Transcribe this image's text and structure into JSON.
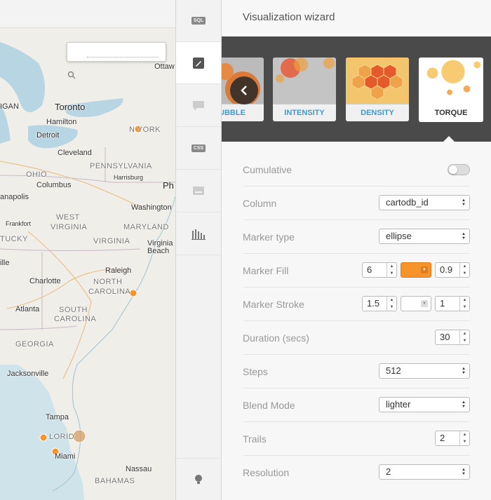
{
  "map": {
    "search": {
      "placeholder": ""
    },
    "labels": [
      {
        "id": "ottawa",
        "text": "Ottaw"
      },
      {
        "id": "toronto",
        "text": "Toronto"
      },
      {
        "id": "hamilton",
        "text": "Hamilton"
      },
      {
        "id": "michigan",
        "text": "IGAN"
      },
      {
        "id": "detroit",
        "text": "Detroit"
      },
      {
        "id": "newyork",
        "text": "N  YORK"
      },
      {
        "id": "cleveland",
        "text": "Cleveland"
      },
      {
        "id": "ohio",
        "text": "OHIO"
      },
      {
        "id": "pennsylvania",
        "text": "PENNSYLVANIA"
      },
      {
        "id": "harrisburg",
        "text": "Harrisburg"
      },
      {
        "id": "columbus",
        "text": "Columbus"
      },
      {
        "id": "ph",
        "text": "Ph"
      },
      {
        "id": "indianapolis",
        "text": "anapolis"
      },
      {
        "id": "westvirginia1",
        "text": "WEST"
      },
      {
        "id": "washington",
        "text": "Washington"
      },
      {
        "id": "frankfort",
        "text": "Frankfort"
      },
      {
        "id": "westvirginia2",
        "text": "VIRGINIA"
      },
      {
        "id": "maryland",
        "text": "MARYLAND"
      },
      {
        "id": "kentucky",
        "text": "TUCKY"
      },
      {
        "id": "virginia",
        "text": "VIRGINIA"
      },
      {
        "id": "virginiabeach1",
        "text": "Virginia"
      },
      {
        "id": "virginiabeach2",
        "text": "Beach"
      },
      {
        "id": "nashville",
        "text": "ille"
      },
      {
        "id": "raleigh",
        "text": "Raleigh"
      },
      {
        "id": "charlotte",
        "text": "Charlotte"
      },
      {
        "id": "northcarolina1",
        "text": "NORTH"
      },
      {
        "id": "northcarolina2",
        "text": "CAROLINA"
      },
      {
        "id": "atlanta",
        "text": "Atlanta"
      },
      {
        "id": "southcarolina1",
        "text": "SOUTH"
      },
      {
        "id": "southcarolina2",
        "text": "CAROLINA"
      },
      {
        "id": "georgia",
        "text": "GEORGIA"
      },
      {
        "id": "jacksonville",
        "text": "Jacksonville"
      },
      {
        "id": "tampa",
        "text": "Tampa"
      },
      {
        "id": "florida",
        "text": "LORID"
      },
      {
        "id": "miami",
        "text": "Miami"
      },
      {
        "id": "nassau",
        "text": "Nassau"
      },
      {
        "id": "bahamas",
        "text": "BAHAMAS"
      }
    ]
  },
  "rail": {
    "sql_badge": "SQL",
    "css_badge": "CSS"
  },
  "panel": {
    "title": "Visualization wizard",
    "viz_types": [
      {
        "label": "UBBLE"
      },
      {
        "label": "INTENSITY"
      },
      {
        "label": "DENSITY"
      },
      {
        "label": "TORQUE"
      }
    ],
    "selected_type": "TORQUE",
    "rows": {
      "cumulative": {
        "label": "Cumulative"
      },
      "column": {
        "label": "Column",
        "value": "cartodb_id"
      },
      "marker_type": {
        "label": "Marker type",
        "value": "ellipse"
      },
      "marker_fill": {
        "label": "Marker Fill",
        "width": "6",
        "opacity": "0.9",
        "color": "#f7932b"
      },
      "marker_stroke": {
        "label": "Marker Stroke",
        "width": "1.5",
        "opacity": "1",
        "color": "#ffffff"
      },
      "duration": {
        "label": "Duration (secs)",
        "value": "30"
      },
      "steps": {
        "label": "Steps",
        "value": "512"
      },
      "blend_mode": {
        "label": "Blend Mode",
        "value": "lighter"
      },
      "trails": {
        "label": "Trails",
        "value": "2"
      },
      "resolution": {
        "label": "Resolution",
        "value": "2"
      }
    }
  },
  "colors": {
    "accent": "#3d9ad1",
    "marker": "#f7932b",
    "carousel_bg": "#4a4a4a"
  }
}
